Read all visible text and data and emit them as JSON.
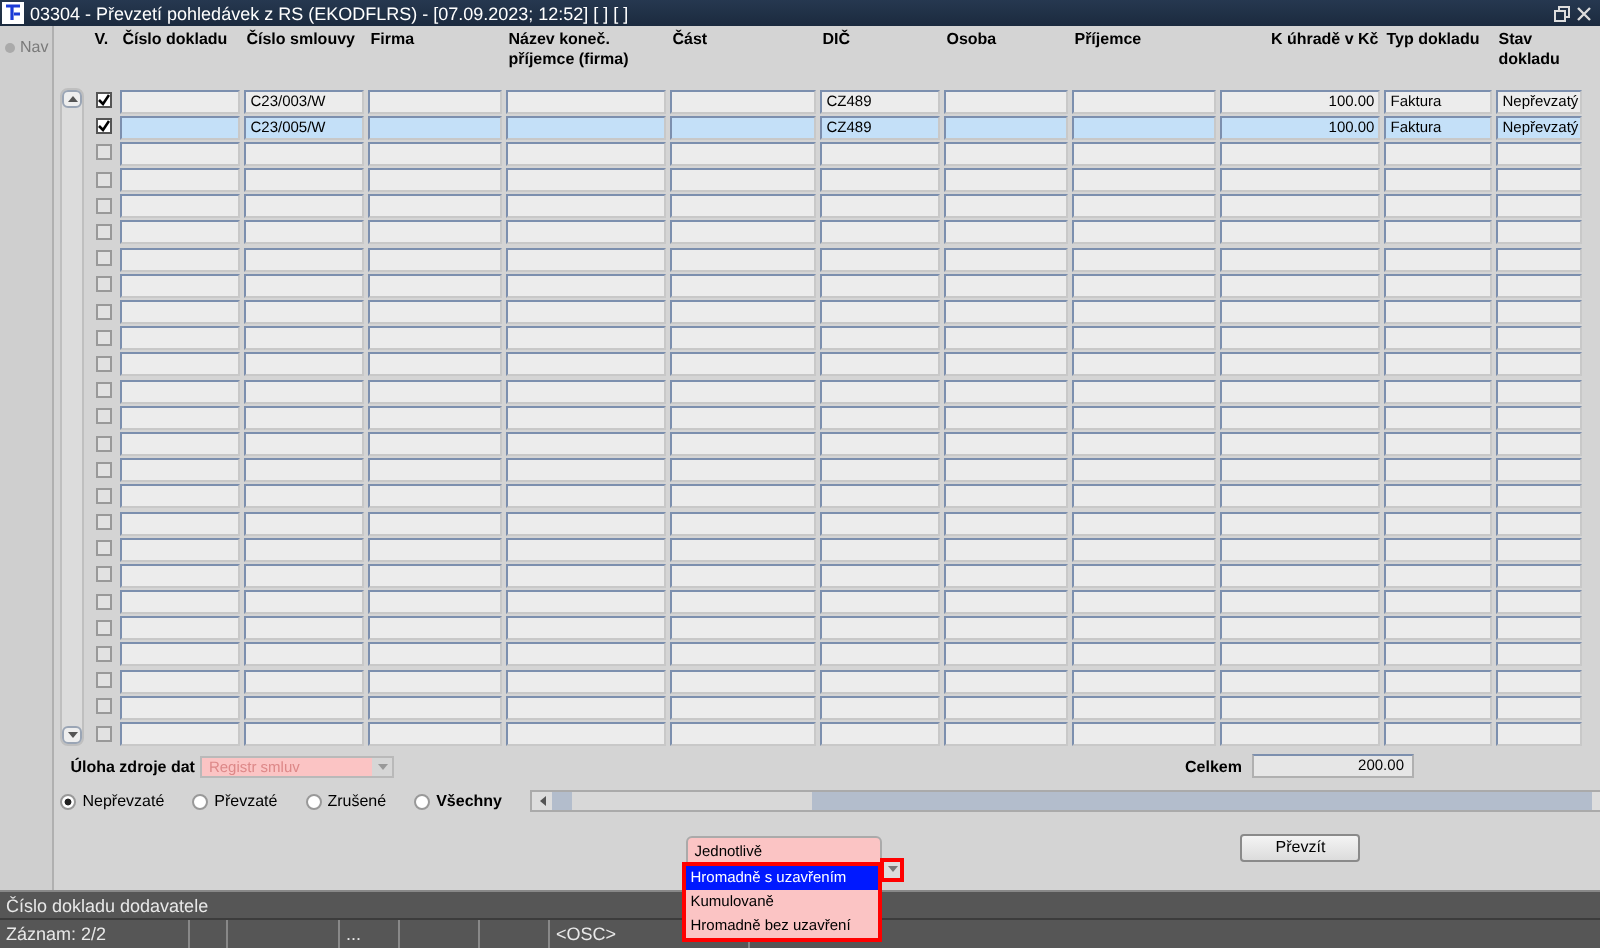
{
  "window": {
    "title": "03304 - Převzetí pohledávek z RS (EKODFLRS) - [07.09.2023; 12:52] [ ] [ ]"
  },
  "nav": {
    "label": "Nav",
    "disabled": true
  },
  "table": {
    "check_label": "V.",
    "columns": [
      {
        "label": "Číslo dokladu",
        "kind": "text"
      },
      {
        "label": "Číslo smlouvy",
        "kind": "text"
      },
      {
        "label": "Firma",
        "kind": "text"
      },
      {
        "label": "Název koneč. příjemce (firma)",
        "kind": "text"
      },
      {
        "label": "Část",
        "kind": "text"
      },
      {
        "label": "DIČ",
        "kind": "text"
      },
      {
        "label": "Osoba",
        "kind": "text"
      },
      {
        "label": "Příjemce",
        "kind": "text"
      },
      {
        "label": "K úhradě v Kč",
        "kind": "amount"
      },
      {
        "label": "Typ dokladu",
        "kind": "text"
      },
      {
        "label": "Stav dokladu",
        "kind": "text"
      }
    ],
    "rows": [
      {
        "checked": true,
        "selected": false,
        "cells": [
          null,
          "C23/003/W",
          null,
          null,
          null,
          "CZ489",
          null,
          null,
          "100.00",
          "Faktura",
          "Nepřevzatý"
        ]
      },
      {
        "checked": true,
        "selected": true,
        "cells": [
          null,
          "C23/005/W",
          null,
          null,
          null,
          "CZ489",
          null,
          null,
          "100.00",
          "Faktura",
          "Nepřevzatý"
        ]
      },
      {
        "checked": false,
        "selected": false
      },
      {
        "checked": false,
        "selected": false
      },
      {
        "checked": false,
        "selected": false
      },
      {
        "checked": false,
        "selected": false
      },
      {
        "checked": false,
        "selected": false
      },
      {
        "checked": false,
        "selected": false
      },
      {
        "checked": false,
        "selected": false
      },
      {
        "checked": false,
        "selected": false
      },
      {
        "checked": false,
        "selected": false
      },
      {
        "checked": false,
        "selected": false
      },
      {
        "checked": false,
        "selected": false
      },
      {
        "checked": false,
        "selected": false
      },
      {
        "checked": false,
        "selected": false
      },
      {
        "checked": false,
        "selected": false
      },
      {
        "checked": false,
        "selected": false
      },
      {
        "checked": false,
        "selected": false
      },
      {
        "checked": false,
        "selected": false
      },
      {
        "checked": false,
        "selected": false
      },
      {
        "checked": false,
        "selected": false
      },
      {
        "checked": false,
        "selected": false
      },
      {
        "checked": false,
        "selected": false
      },
      {
        "checked": false,
        "selected": false
      },
      {
        "checked": false,
        "selected": false
      }
    ]
  },
  "source": {
    "label": "Úloha zdroje dat",
    "value": "Registr smluv",
    "disabled": true
  },
  "total": {
    "label": "Celkem",
    "value": "200.00"
  },
  "filters": [
    {
      "label": "Nepřevzaté",
      "selected": true,
      "focused": false
    },
    {
      "label": "Převzaté",
      "selected": false,
      "focused": false
    },
    {
      "label": "Zrušené",
      "selected": false,
      "focused": false
    },
    {
      "label": "Všechny",
      "selected": false,
      "focused": true
    }
  ],
  "mode_dropdown": {
    "value": "Jednotlivě",
    "expanded": true,
    "options": [
      {
        "label": "Hromadně s uzavřením",
        "selected": true
      },
      {
        "label": "Kumulovaně",
        "selected": false
      },
      {
        "label": "Hromadně bez uzavření",
        "selected": false
      }
    ]
  },
  "buttons": [
    "Převzít"
  ],
  "status_bar": {
    "hint": "Číslo dokladu dodavatele",
    "record": "Záznam: 2/2",
    "field_4": "...",
    "field_7": "<OSC>"
  }
}
